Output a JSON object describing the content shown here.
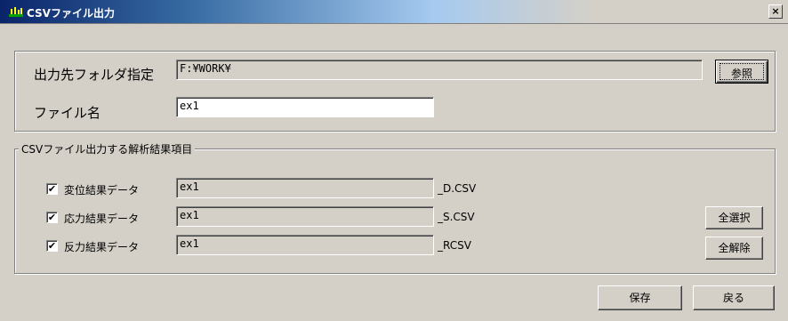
{
  "window": {
    "title": "CSVファイル出力",
    "close_symbol": "×"
  },
  "output": {
    "folder_label": "出力先フォルダ指定",
    "folder_value": "F:¥WORK¥",
    "browse_label": "参照",
    "filename_label": "ファイル名",
    "filename_value": "ex1"
  },
  "items_group": {
    "legend": "CSVファイル出力する解析結果項目",
    "check_mark": "✔",
    "rows": [
      {
        "label": "変位結果データ",
        "checked": true,
        "value": "ex1",
        "suffix": "_D.CSV"
      },
      {
        "label": "応力結果データ",
        "checked": true,
        "value": "ex1",
        "suffix": "_S.CSV"
      },
      {
        "label": "反力結果データ",
        "checked": true,
        "value": "ex1",
        "suffix": "_RCSV"
      }
    ],
    "select_all_label": "全選択",
    "deselect_all_label": "全解除"
  },
  "footer": {
    "save_label": "保存",
    "back_label": "戻る"
  }
}
